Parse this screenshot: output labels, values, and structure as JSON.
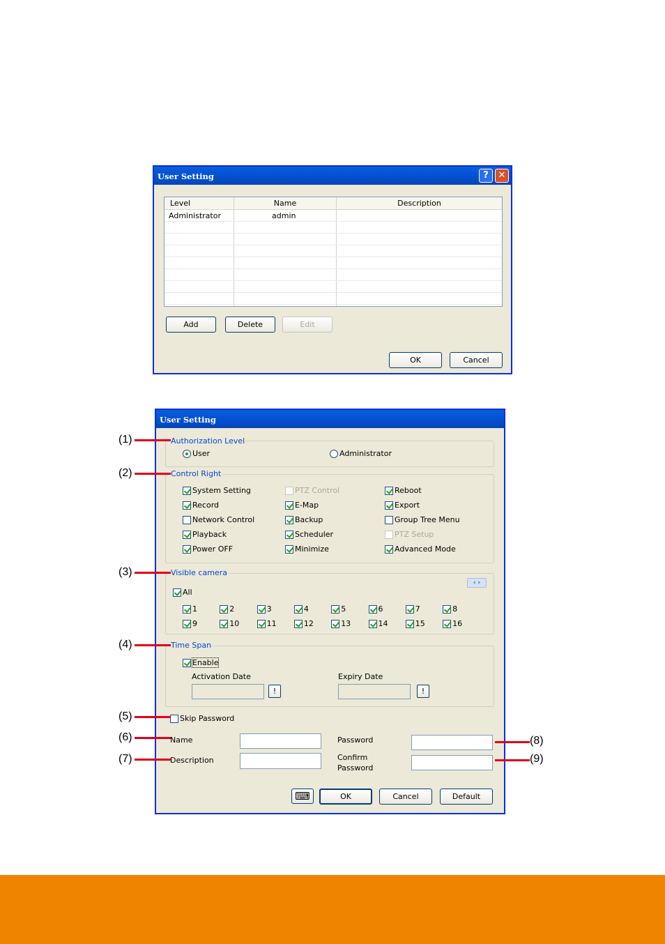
{
  "dialog1": {
    "title": "User Setting",
    "help_glyph": "?",
    "close_glyph": "✕",
    "columns": [
      "Level",
      "Name",
      "Description"
    ],
    "rows": [
      {
        "level": "Administrator",
        "name": "admin",
        "description": ""
      }
    ],
    "buttons": {
      "add": "Add",
      "delete": "Delete",
      "edit": "Edit",
      "ok": "OK",
      "cancel": "Cancel"
    }
  },
  "dialog2": {
    "title": "User Setting",
    "authorization": {
      "label": "Authorization Level",
      "user": "User",
      "administrator": "Administrator",
      "selected": "User"
    },
    "control_right": {
      "label": "Control Right",
      "items": [
        {
          "label": "System Setting",
          "checked": true,
          "enabled": true
        },
        {
          "label": "PTZ Control",
          "checked": false,
          "enabled": false
        },
        {
          "label": "Reboot",
          "checked": true,
          "enabled": true
        },
        {
          "label": "Record",
          "checked": true,
          "enabled": true
        },
        {
          "label": "E-Map",
          "checked": true,
          "enabled": true
        },
        {
          "label": "Export",
          "checked": true,
          "enabled": true
        },
        {
          "label": "Network Control",
          "checked": false,
          "enabled": true
        },
        {
          "label": "Backup",
          "checked": true,
          "enabled": true
        },
        {
          "label": "Group Tree Menu",
          "checked": false,
          "enabled": true
        },
        {
          "label": "Playback",
          "checked": true,
          "enabled": true
        },
        {
          "label": "Scheduler",
          "checked": true,
          "enabled": true
        },
        {
          "label": "PTZ Setup",
          "checked": false,
          "enabled": false
        },
        {
          "label": "Power OFF",
          "checked": true,
          "enabled": true
        },
        {
          "label": "Minimize",
          "checked": true,
          "enabled": true
        },
        {
          "label": "Advanced Mode",
          "checked": true,
          "enabled": true
        }
      ]
    },
    "visible_camera": {
      "label": "Visible camera",
      "all_label": "All",
      "all_checked": true,
      "scroll_glyph": "‹ ›",
      "cameras": [
        "1",
        "2",
        "3",
        "4",
        "5",
        "6",
        "7",
        "8",
        "9",
        "10",
        "11",
        "12",
        "13",
        "14",
        "15",
        "16"
      ]
    },
    "time_span": {
      "label": "Time Span",
      "enable_label": "Enable",
      "enable_checked": true,
      "activation_label": "Activation Date",
      "expiry_label": "Expiry Date",
      "picker_glyph": "!"
    },
    "skip_password": {
      "label": "Skip Password",
      "checked": false
    },
    "name_label": "Name",
    "description_label": "Description",
    "password_label": "Password",
    "confirm_label_1": "Confirm",
    "confirm_label_2": "Password",
    "keyboard_glyph": "⌨",
    "buttons": {
      "ok": "OK",
      "cancel": "Cancel",
      "default": "Default"
    }
  },
  "annotations": [
    "(1)",
    "(2)",
    "(3)",
    "(4)",
    "(5)",
    "(6)",
    "(7)",
    "(8)",
    "(9)"
  ],
  "colors": {
    "footer": "#ee8400",
    "annotation_line": "#e0001a",
    "title_bar": "#0553d8"
  }
}
